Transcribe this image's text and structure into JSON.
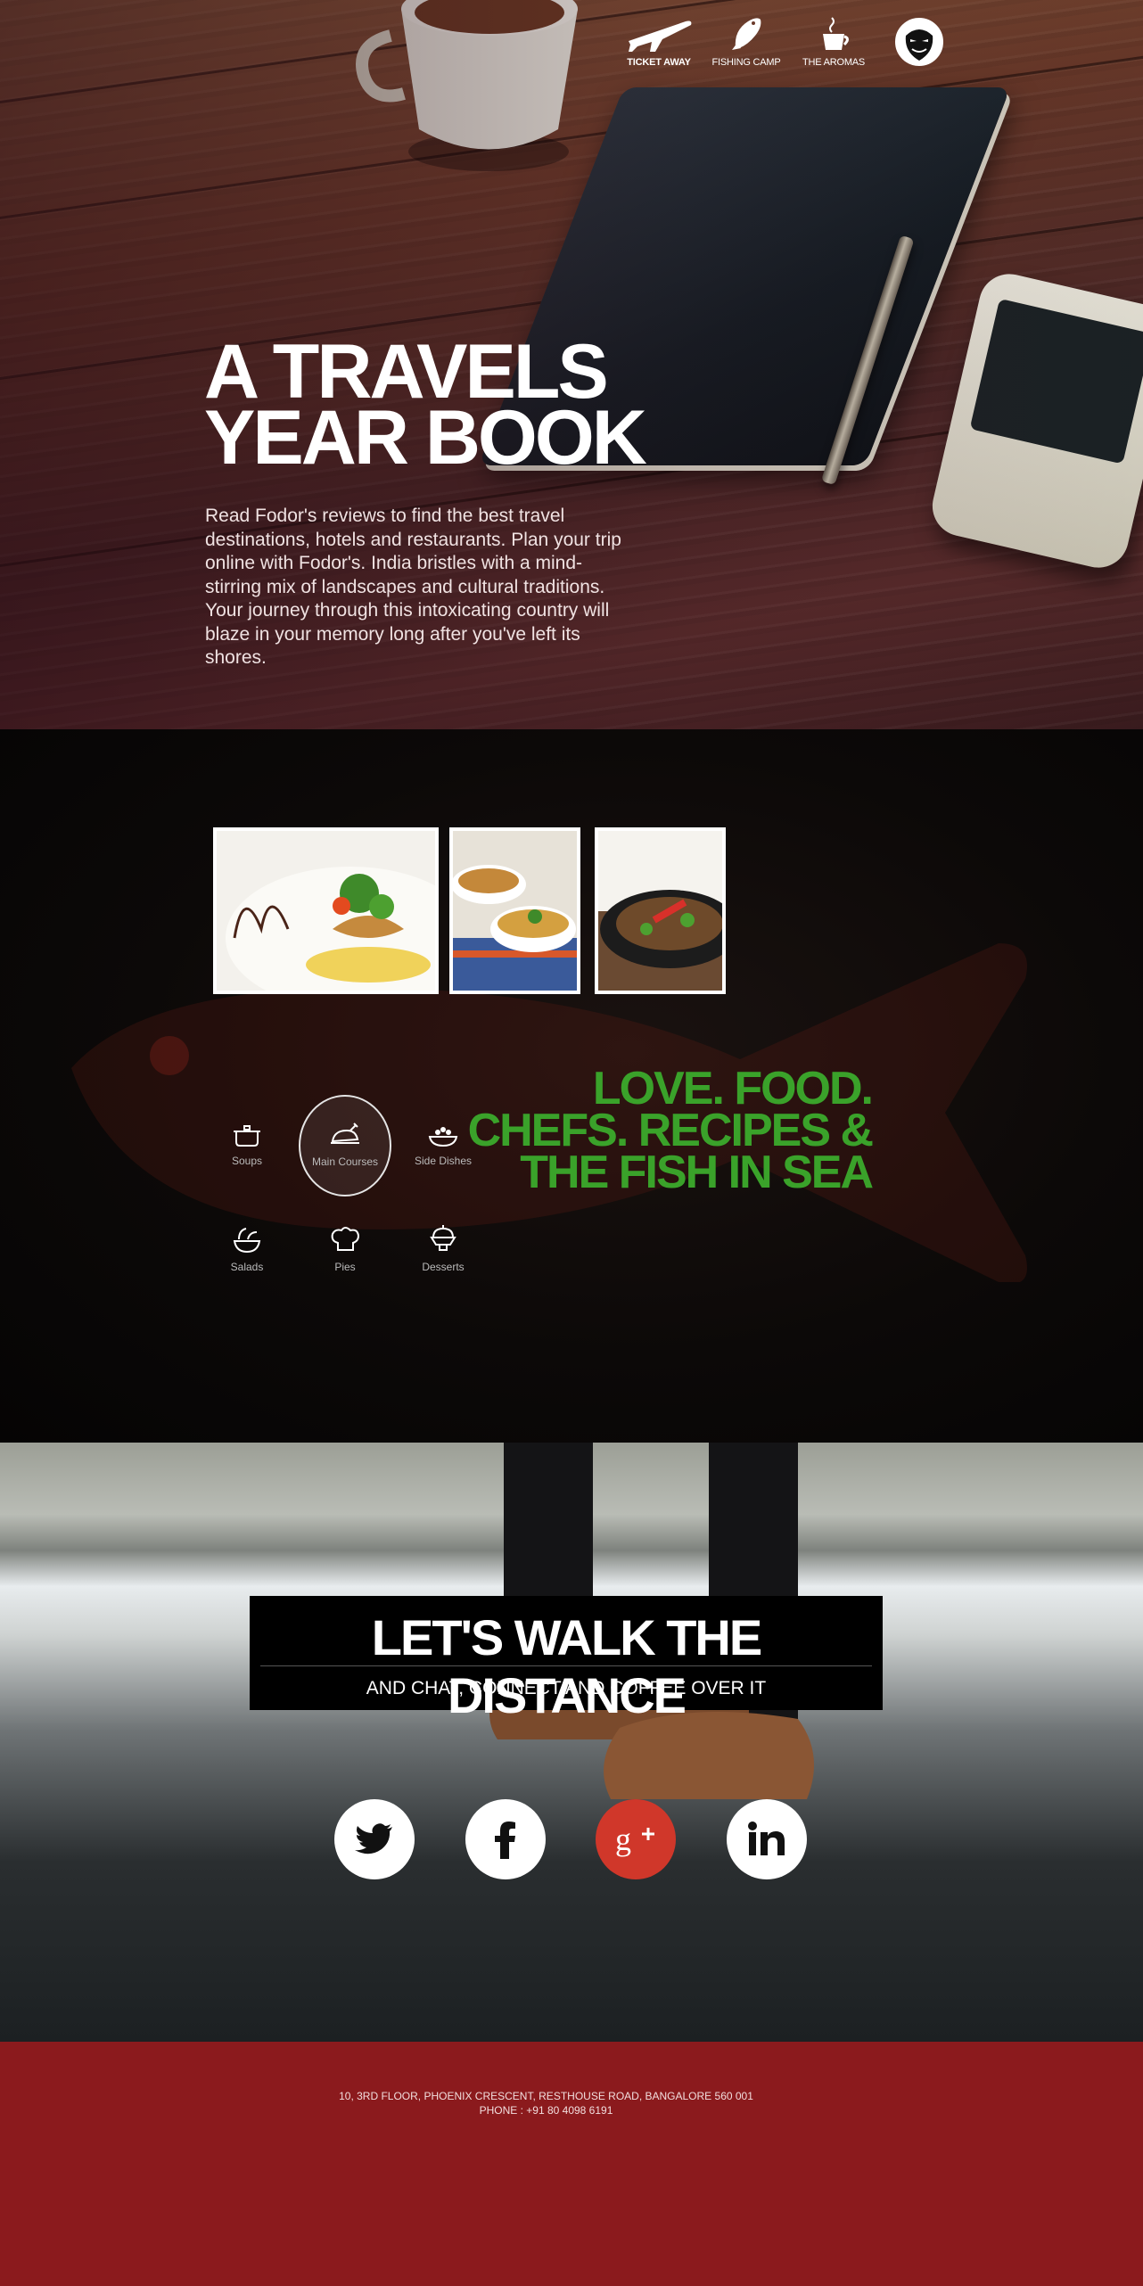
{
  "nav": {
    "items": [
      {
        "label": "TICKET AWAY",
        "icon": "airplane-icon",
        "active": true
      },
      {
        "label": "FISHING CAMP",
        "icon": "fish-icon",
        "active": false
      },
      {
        "label": "THE AROMAS",
        "icon": "coffee-cup-icon",
        "active": false
      }
    ],
    "avatar_icon": "guy-fawkes-mask-icon"
  },
  "hero": {
    "title_line1": "A TRAVELS",
    "title_line2": "YEAR BOOK",
    "body": "Read Fodor's reviews to find the best travel destinations, hotels and restaurants. Plan your trip online with Fodor's. India bristles with a mind-stirring mix of landscapes and cultural traditions. Your journey through this intoxicating country will blaze in your memory long after you've left its shores."
  },
  "food": {
    "categories": [
      {
        "label": "Soups",
        "icon": "pot-icon",
        "active": false
      },
      {
        "label": "Main Courses",
        "icon": "roast-chicken-icon",
        "active": true
      },
      {
        "label": "Side Dishes",
        "icon": "side-dish-bowl-icon",
        "active": false
      },
      {
        "label": "Salads",
        "icon": "salad-bowl-icon",
        "active": false
      },
      {
        "label": "Pies",
        "icon": "chef-hat-icon",
        "active": false
      },
      {
        "label": "Desserts",
        "icon": "dessert-cup-icon",
        "active": false
      }
    ],
    "headline_line1": "LOVE. FOOD.",
    "headline_line2": "CHEFS. RECIPES &",
    "headline_line3": "THE FISH IN SEA",
    "accent_color": "#3aa22a"
  },
  "walk": {
    "title": "LET'S WALK THE DISTANCE",
    "subtitle": "AND CHAT, CONNECT AND COFFEE OVER IT",
    "social": [
      {
        "icon": "twitter-icon"
      },
      {
        "icon": "facebook-icon"
      },
      {
        "icon": "google-plus-icon",
        "color": "#d0372a"
      },
      {
        "icon": "linkedin-icon"
      }
    ]
  },
  "footer": {
    "address": "10, 3RD FLOOR, PHOENIX CRESCENT, RESTHOUSE ROAD, BANGALORE 560 001",
    "phone": "PHONE : +91 80 4098 6191",
    "background": "#8b1a1d"
  }
}
